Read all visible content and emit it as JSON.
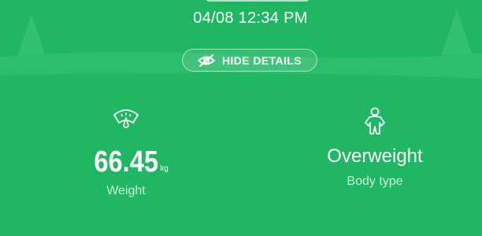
{
  "header": {
    "datetime": "04/08 12:34 PM",
    "hide_details_label": "HIDE DETAILS",
    "hide_details_icon": "eye-off-icon"
  },
  "metrics": {
    "weight": {
      "value": "66.45",
      "unit": "kg",
      "label": "Weight",
      "icon": "scale-icon"
    },
    "body_type": {
      "value": "Overweight",
      "label": "Body type",
      "icon": "person-icon"
    }
  },
  "colors": {
    "background": "#1fb763",
    "header_hills": "#3dc679",
    "trees": "#33bf70",
    "text": "#ffffff"
  }
}
